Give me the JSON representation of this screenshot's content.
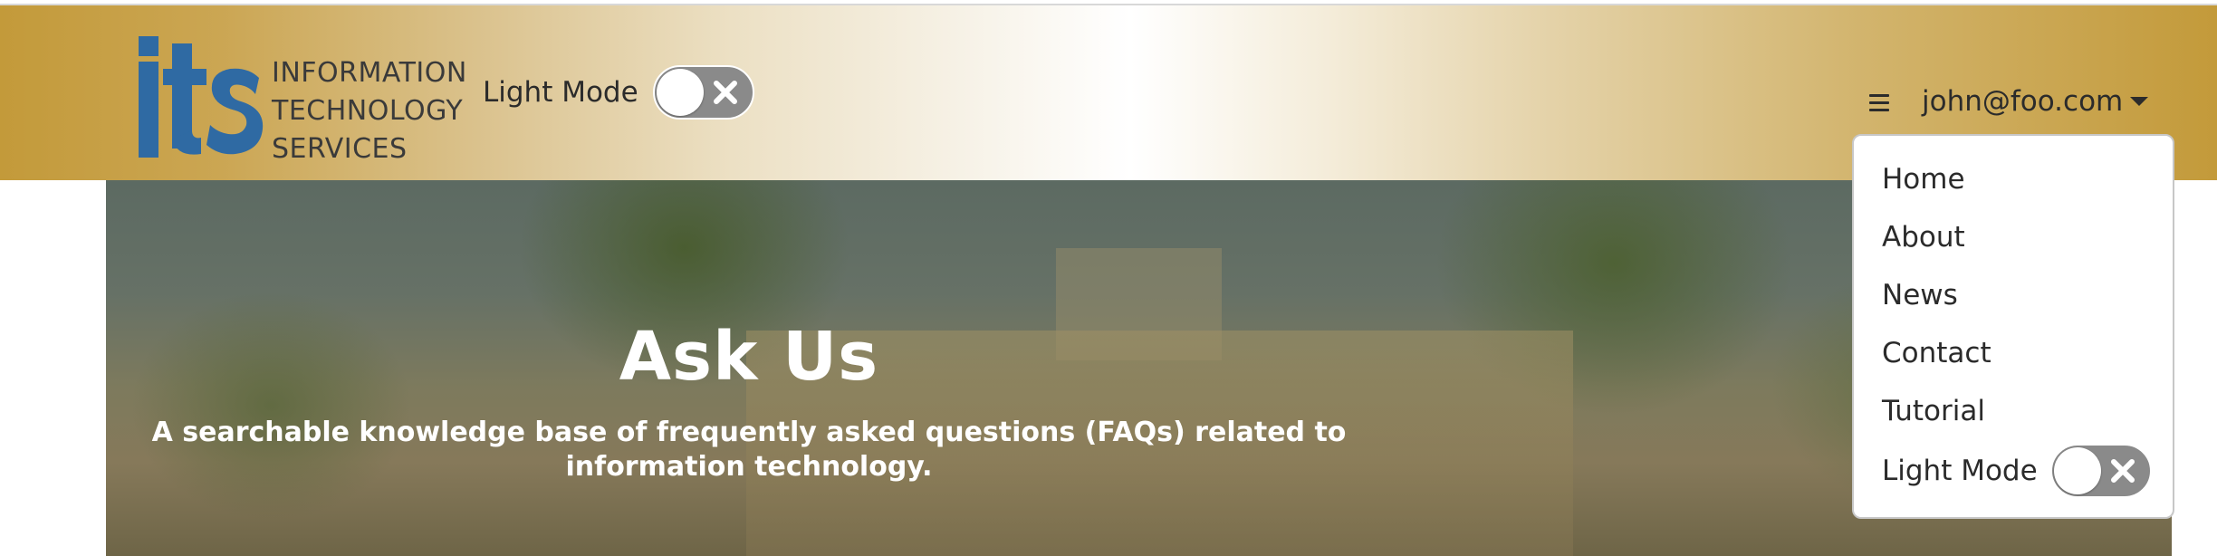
{
  "header": {
    "logo": {
      "mark": "its",
      "lines": [
        "INFORMATION",
        "TECHNOLOGY",
        "SERVICES"
      ],
      "mark_color": "#2f6aa3"
    },
    "theme_toggle": {
      "label": "Light Mode",
      "checked": false
    },
    "user_menu": {
      "label": "john@foo.com"
    }
  },
  "hero": {
    "title": "Ask Us",
    "subtitle": "A searchable knowledge base of frequently asked questions (FAQs) related to information technology."
  },
  "dropdown": {
    "items": [
      "Home",
      "About",
      "News",
      "Contact",
      "Tutorial"
    ],
    "theme_toggle": {
      "label": "Light Mode",
      "checked": false
    }
  },
  "colors": {
    "header_gold": "#c39a3a",
    "toggle_track": "#8a8a8a",
    "text_dark": "#2b2b2b"
  },
  "icons": [
    "hamburger-icon",
    "caret-down-icon",
    "close-icon"
  ]
}
